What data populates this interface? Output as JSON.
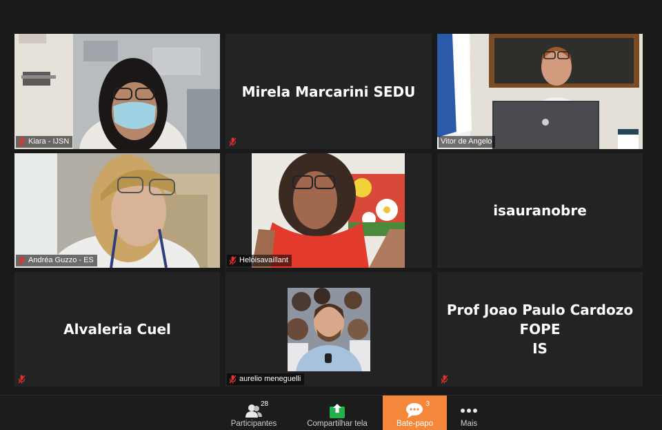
{
  "participants": [
    {
      "id": "kiara",
      "label": "Kiara - IJSN",
      "muted": true,
      "has_video": true
    },
    {
      "id": "mirela",
      "display": "Mirela Marcarini SEDU",
      "muted": true,
      "has_video": false
    },
    {
      "id": "vitor",
      "label": "Vitor de Angelo",
      "muted": false,
      "has_video": true
    },
    {
      "id": "andrea",
      "label": "Andréa Guzzo - ES",
      "muted": true,
      "has_video": true
    },
    {
      "id": "heloisa",
      "label": "Heloisavaillant",
      "muted": true,
      "has_video": true
    },
    {
      "id": "isaura",
      "display": "isauranobre",
      "muted": false,
      "has_video": false
    },
    {
      "id": "alvaleria",
      "display": "Alvaleria Cuel",
      "muted": true,
      "has_video": false
    },
    {
      "id": "aurelio",
      "label": "aurelio meneguelli",
      "muted": true,
      "has_video": true
    },
    {
      "id": "joao",
      "display_line1": "Prof Joao Paulo Cardozo FOPE",
      "display_line2": "IS",
      "muted": true,
      "has_video": false
    }
  ],
  "toolbar": {
    "participants": {
      "label": "Participantes",
      "count": "28",
      "icon": "participants-icon"
    },
    "share": {
      "label": "Compartilhar tela",
      "icon": "share-screen-icon"
    },
    "chat": {
      "label": "Bate-papo",
      "count": "3",
      "icon": "chat-icon",
      "active": true
    },
    "more": {
      "label": "Mais",
      "icon": "more-icon"
    }
  },
  "colors": {
    "accent": "#f5873a",
    "share_green": "#22b14c",
    "tile_bg": "#232323",
    "muted_red": "#e03030"
  }
}
